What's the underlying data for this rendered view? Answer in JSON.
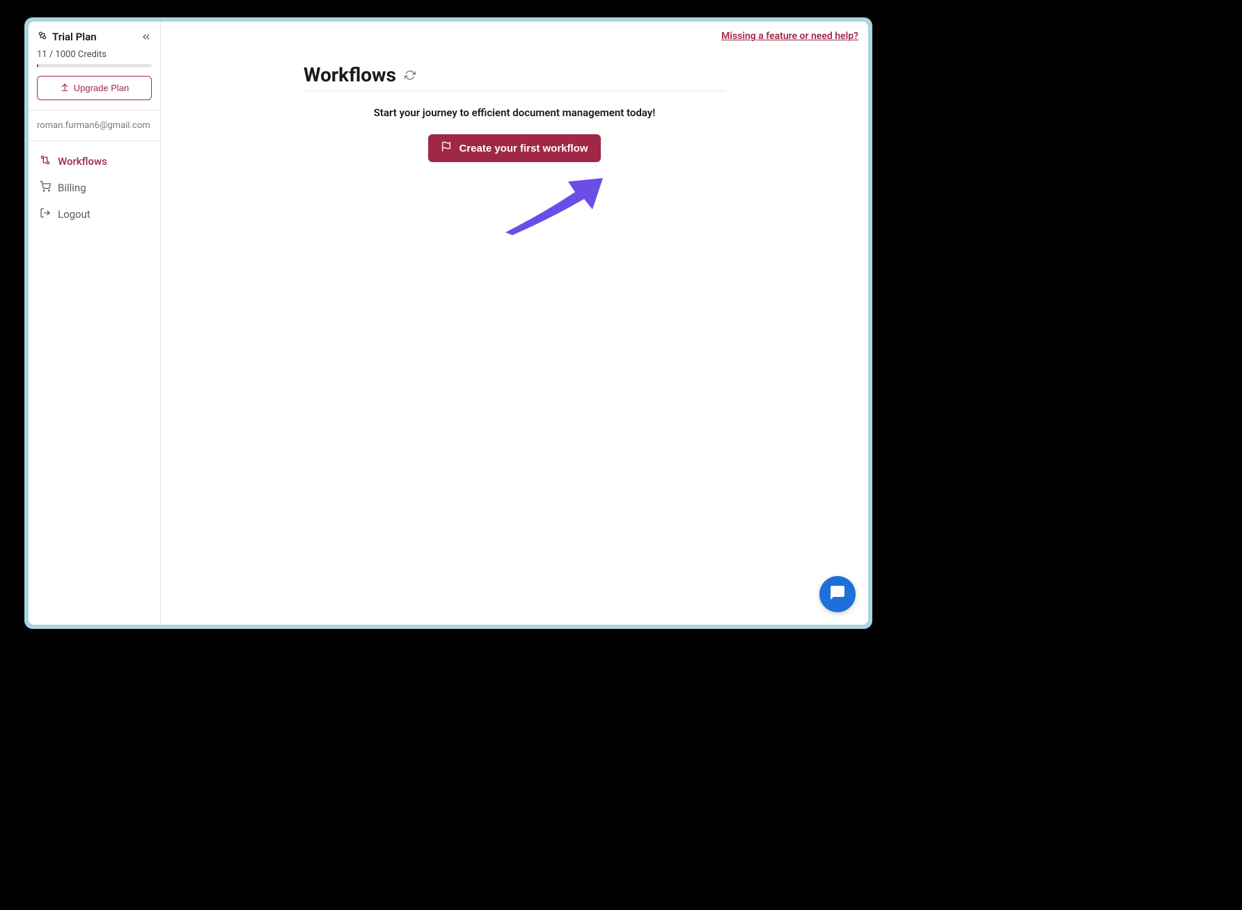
{
  "sidebar": {
    "plan_label": "Trial Plan",
    "credits_text": "11 / 1000 Credits",
    "credits_used": 11,
    "credits_total": 1000,
    "upgrade_label": "Upgrade Plan",
    "user_email": "roman.furman6@gmail.com",
    "nav": [
      {
        "label": "Workflows",
        "icon": "workflows-icon",
        "active": true
      },
      {
        "label": "Billing",
        "icon": "cart-icon",
        "active": false
      },
      {
        "label": "Logout",
        "icon": "logout-icon",
        "active": false
      }
    ]
  },
  "header": {
    "help_link": "Missing a feature or need help?"
  },
  "main": {
    "page_title": "Workflows",
    "journey_text": "Start your journey to efficient document management today!",
    "create_button": "Create your first workflow"
  },
  "colors": {
    "accent": "#a02846",
    "frame": "#a8d5e2",
    "chat": "#1e6fd9",
    "arrow": "#6b4ee6"
  }
}
